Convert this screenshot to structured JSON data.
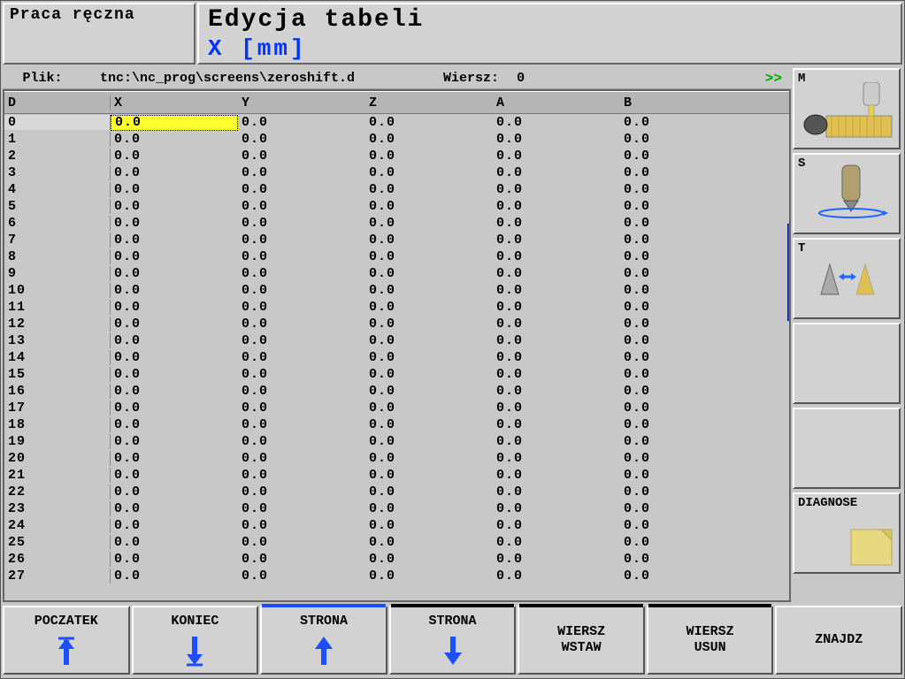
{
  "header": {
    "mode": "Praca ręczna",
    "title": "Edycja tabeli",
    "sub": "X  [mm]"
  },
  "filebar": {
    "label": "Plik:",
    "path": "tnc:\\nc_prog\\screens\\zeroshift.d",
    "rowlabel": "Wiersz:",
    "row": "0",
    "more": ">>"
  },
  "columns": [
    "D",
    "X",
    "Y",
    "Z",
    "A",
    "B"
  ],
  "rows": [
    {
      "d": "0",
      "x": "0.0",
      "y": "0.0",
      "z": "0.0",
      "a": "0.0",
      "b": "0.0"
    },
    {
      "d": "1",
      "x": "0.0",
      "y": "0.0",
      "z": "0.0",
      "a": "0.0",
      "b": "0.0"
    },
    {
      "d": "2",
      "x": "0.0",
      "y": "0.0",
      "z": "0.0",
      "a": "0.0",
      "b": "0.0"
    },
    {
      "d": "3",
      "x": "0.0",
      "y": "0.0",
      "z": "0.0",
      "a": "0.0",
      "b": "0.0"
    },
    {
      "d": "4",
      "x": "0.0",
      "y": "0.0",
      "z": "0.0",
      "a": "0.0",
      "b": "0.0"
    },
    {
      "d": "5",
      "x": "0.0",
      "y": "0.0",
      "z": "0.0",
      "a": "0.0",
      "b": "0.0"
    },
    {
      "d": "6",
      "x": "0.0",
      "y": "0.0",
      "z": "0.0",
      "a": "0.0",
      "b": "0.0"
    },
    {
      "d": "7",
      "x": "0.0",
      "y": "0.0",
      "z": "0.0",
      "a": "0.0",
      "b": "0.0"
    },
    {
      "d": "8",
      "x": "0.0",
      "y": "0.0",
      "z": "0.0",
      "a": "0.0",
      "b": "0.0"
    },
    {
      "d": "9",
      "x": "0.0",
      "y": "0.0",
      "z": "0.0",
      "a": "0.0",
      "b": "0.0"
    },
    {
      "d": "10",
      "x": "0.0",
      "y": "0.0",
      "z": "0.0",
      "a": "0.0",
      "b": "0.0"
    },
    {
      "d": "11",
      "x": "0.0",
      "y": "0.0",
      "z": "0.0",
      "a": "0.0",
      "b": "0.0"
    },
    {
      "d": "12",
      "x": "0.0",
      "y": "0.0",
      "z": "0.0",
      "a": "0.0",
      "b": "0.0"
    },
    {
      "d": "13",
      "x": "0.0",
      "y": "0.0",
      "z": "0.0",
      "a": "0.0",
      "b": "0.0"
    },
    {
      "d": "14",
      "x": "0.0",
      "y": "0.0",
      "z": "0.0",
      "a": "0.0",
      "b": "0.0"
    },
    {
      "d": "15",
      "x": "0.0",
      "y": "0.0",
      "z": "0.0",
      "a": "0.0",
      "b": "0.0"
    },
    {
      "d": "16",
      "x": "0.0",
      "y": "0.0",
      "z": "0.0",
      "a": "0.0",
      "b": "0.0"
    },
    {
      "d": "17",
      "x": "0.0",
      "y": "0.0",
      "z": "0.0",
      "a": "0.0",
      "b": "0.0"
    },
    {
      "d": "18",
      "x": "0.0",
      "y": "0.0",
      "z": "0.0",
      "a": "0.0",
      "b": "0.0"
    },
    {
      "d": "19",
      "x": "0.0",
      "y": "0.0",
      "z": "0.0",
      "a": "0.0",
      "b": "0.0"
    },
    {
      "d": "20",
      "x": "0.0",
      "y": "0.0",
      "z": "0.0",
      "a": "0.0",
      "b": "0.0"
    },
    {
      "d": "21",
      "x": "0.0",
      "y": "0.0",
      "z": "0.0",
      "a": "0.0",
      "b": "0.0"
    },
    {
      "d": "22",
      "x": "0.0",
      "y": "0.0",
      "z": "0.0",
      "a": "0.0",
      "b": "0.0"
    },
    {
      "d": "23",
      "x": "0.0",
      "y": "0.0",
      "z": "0.0",
      "a": "0.0",
      "b": "0.0"
    },
    {
      "d": "24",
      "x": "0.0",
      "y": "0.0",
      "z": "0.0",
      "a": "0.0",
      "b": "0.0"
    },
    {
      "d": "25",
      "x": "0.0",
      "y": "0.0",
      "z": "0.0",
      "a": "0.0",
      "b": "0.0"
    },
    {
      "d": "26",
      "x": "0.0",
      "y": "0.0",
      "z": "0.0",
      "a": "0.0",
      "b": "0.0"
    },
    {
      "d": "27",
      "x": "0.0",
      "y": "0.0",
      "z": "0.0",
      "a": "0.0",
      "b": "0.0"
    }
  ],
  "selected_row": 0,
  "selected_col": "x",
  "sidebar": {
    "m": "M",
    "s": "S",
    "t": "T",
    "diag": "DIAGNOSE"
  },
  "softkeys": {
    "k0": "POCZATEK",
    "k1": "KONIEC",
    "k2": "STRONA",
    "k3": "STRONA",
    "k4a": "WIERSZ",
    "k4b": "WSTAW",
    "k5a": "WIERSZ",
    "k5b": "USUN",
    "k6": "ZNAJDZ"
  }
}
